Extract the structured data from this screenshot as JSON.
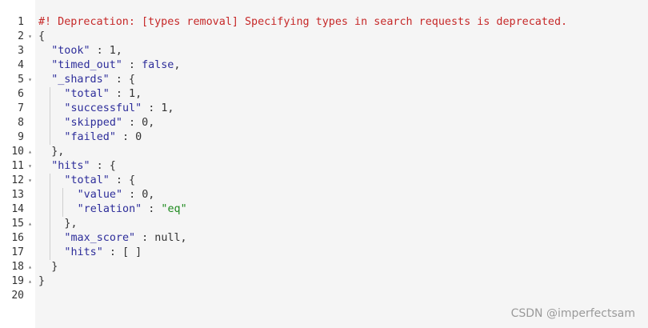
{
  "editor": {
    "lines": [
      {
        "n": "1",
        "fold": "",
        "indent": 0,
        "parts": [
          {
            "t": "#! Deprecation: [types removal] Specifying types in search requests is deprecated.",
            "c": "comment"
          }
        ]
      },
      {
        "n": "2",
        "fold": "▾",
        "indent": 0,
        "parts": [
          {
            "t": "{",
            "c": "punct"
          }
        ]
      },
      {
        "n": "3",
        "fold": "",
        "indent": 1,
        "parts": [
          {
            "t": "\"took\"",
            "c": "str"
          },
          {
            "t": " : 1,",
            "c": "punct"
          }
        ]
      },
      {
        "n": "4",
        "fold": "",
        "indent": 1,
        "parts": [
          {
            "t": "\"timed_out\"",
            "c": "str"
          },
          {
            "t": " : ",
            "c": "punct"
          },
          {
            "t": "false",
            "c": "kw"
          },
          {
            "t": ",",
            "c": "punct"
          }
        ]
      },
      {
        "n": "5",
        "fold": "▾",
        "indent": 1,
        "parts": [
          {
            "t": "\"_shards\"",
            "c": "str"
          },
          {
            "t": " : {",
            "c": "punct"
          }
        ]
      },
      {
        "n": "6",
        "fold": "",
        "indent": 2,
        "parts": [
          {
            "t": "\"total\"",
            "c": "str"
          },
          {
            "t": " : 1,",
            "c": "punct"
          }
        ]
      },
      {
        "n": "7",
        "fold": "",
        "indent": 2,
        "parts": [
          {
            "t": "\"successful\"",
            "c": "str"
          },
          {
            "t": " : 1,",
            "c": "punct"
          }
        ]
      },
      {
        "n": "8",
        "fold": "",
        "indent": 2,
        "parts": [
          {
            "t": "\"skipped\"",
            "c": "str"
          },
          {
            "t": " : 0,",
            "c": "punct"
          }
        ]
      },
      {
        "n": "9",
        "fold": "",
        "indent": 2,
        "parts": [
          {
            "t": "\"failed\"",
            "c": "str"
          },
          {
            "t": " : 0",
            "c": "punct"
          }
        ]
      },
      {
        "n": "10",
        "fold": "▴",
        "indent": 1,
        "parts": [
          {
            "t": "},",
            "c": "punct"
          }
        ]
      },
      {
        "n": "11",
        "fold": "▾",
        "indent": 1,
        "parts": [
          {
            "t": "\"hits\"",
            "c": "str"
          },
          {
            "t": " : {",
            "c": "punct"
          }
        ]
      },
      {
        "n": "12",
        "fold": "▾",
        "indent": 2,
        "parts": [
          {
            "t": "\"total\"",
            "c": "str"
          },
          {
            "t": " : {",
            "c": "punct"
          }
        ]
      },
      {
        "n": "13",
        "fold": "",
        "indent": 3,
        "parts": [
          {
            "t": "\"value\"",
            "c": "str"
          },
          {
            "t": " : 0,",
            "c": "punct"
          }
        ]
      },
      {
        "n": "14",
        "fold": "",
        "indent": 3,
        "parts": [
          {
            "t": "\"relation\"",
            "c": "str"
          },
          {
            "t": " : ",
            "c": "punct"
          },
          {
            "t": "\"eq\"",
            "c": "val-str"
          }
        ]
      },
      {
        "n": "15",
        "fold": "▴",
        "indent": 2,
        "parts": [
          {
            "t": "},",
            "c": "punct"
          }
        ]
      },
      {
        "n": "16",
        "fold": "",
        "indent": 2,
        "parts": [
          {
            "t": "\"max_score\"",
            "c": "str"
          },
          {
            "t": " : null,",
            "c": "punct"
          }
        ]
      },
      {
        "n": "17",
        "fold": "",
        "indent": 2,
        "parts": [
          {
            "t": "\"hits\"",
            "c": "str"
          },
          {
            "t": " : [ ]",
            "c": "punct"
          }
        ]
      },
      {
        "n": "18",
        "fold": "▴",
        "indent": 1,
        "parts": [
          {
            "t": "}",
            "c": "punct"
          }
        ]
      },
      {
        "n": "19",
        "fold": "▴",
        "indent": 0,
        "parts": [
          {
            "t": "}",
            "c": "punct"
          }
        ]
      },
      {
        "n": "20",
        "fold": "",
        "indent": 0,
        "parts": []
      }
    ]
  },
  "colors": {
    "comment": "#c62828",
    "key": "#2d2d9a",
    "string_value": "#1e8a1e",
    "background": "#f5f5f5"
  },
  "watermark": "CSDN @imperfectsam"
}
